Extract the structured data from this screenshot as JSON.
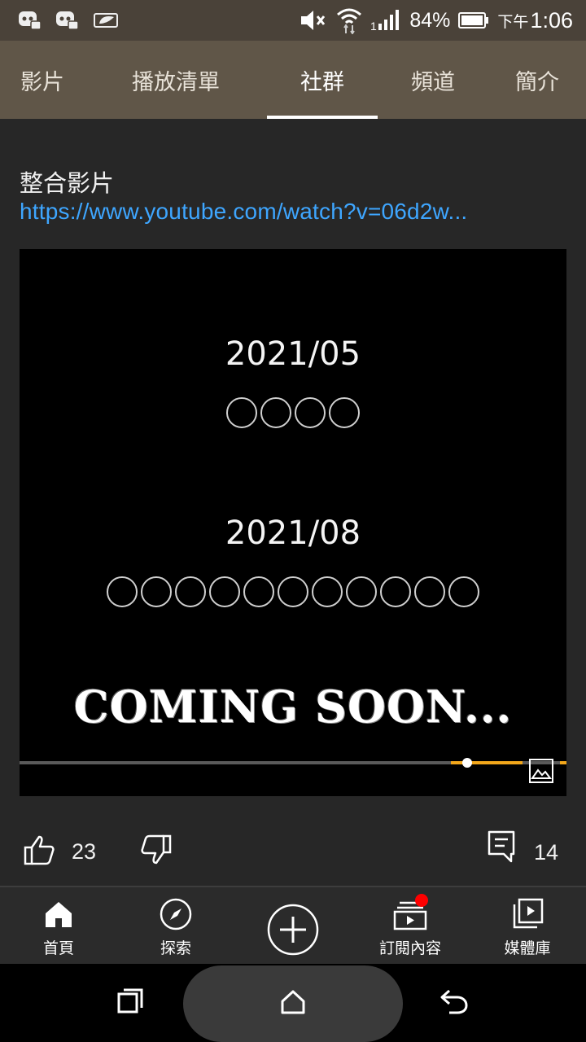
{
  "status": {
    "battery_percent": "84%",
    "time_prefix": "下午",
    "time": "1:06",
    "icons": [
      "discord-icon",
      "discord-icon",
      "leaf-battery-icon",
      "mute-icon",
      "wifi-icon",
      "signal-icon",
      "battery-icon"
    ]
  },
  "tabs": [
    {
      "label": "影片",
      "active": false
    },
    {
      "label": "播放清單",
      "active": false
    },
    {
      "label": "社群",
      "active": true
    },
    {
      "label": "頻道",
      "active": false
    },
    {
      "label": "簡介",
      "active": false
    }
  ],
  "post": {
    "text": "整合影片",
    "link": "https://www.youtube.com/watch?v=06d2w...",
    "image": {
      "date1": "2021/05",
      "date1_circles": 4,
      "date2": "2021/08",
      "date2_circles": 11,
      "coming_text": "COMING SOON..."
    },
    "likes": "23",
    "comments": "14"
  },
  "colors": {
    "status_bg": "#4a4239",
    "tab_bg": "#605648",
    "link": "#3ea6ff",
    "progress": "#f2a71b",
    "notification_dot": "#ff0000"
  },
  "bottom_nav": [
    {
      "label": "首頁",
      "icon": "home-icon"
    },
    {
      "label": "探索",
      "icon": "compass-icon"
    },
    {
      "label": "",
      "icon": "add-icon"
    },
    {
      "label": "訂閱內容",
      "icon": "subscriptions-icon"
    },
    {
      "label": "媒體庫",
      "icon": "library-icon"
    }
  ]
}
